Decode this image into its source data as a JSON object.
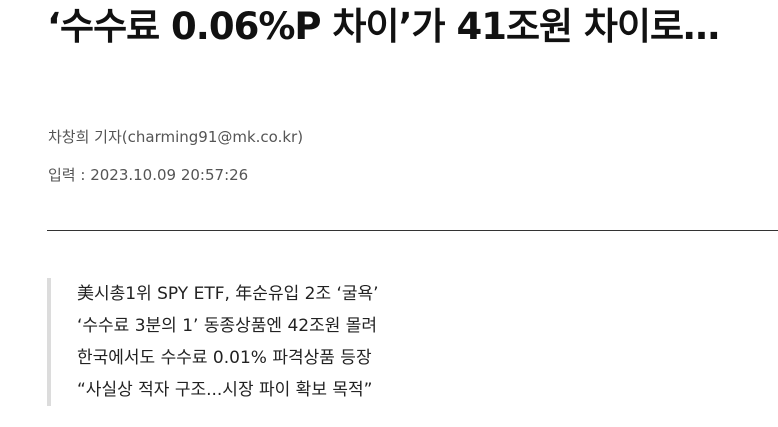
{
  "article": {
    "headline": "‘수수료 0.06%P 차이’가 41조원 차이로…",
    "byline": "차창희 기자(charming91@mk.co.kr)",
    "dateline": "입력 : 2023.10.09 20:57:26",
    "summary": [
      "美시총1위 SPY ETF, 年순유입 2조 ‘굴욕’",
      "‘수수료 3분의 1’ 동종상품엔 42조원 몰려",
      "한국에서도 수수료 0.01% 파격상품 등장",
      "“사실상 적자 구조...시장 파이 확보 목적”"
    ]
  }
}
